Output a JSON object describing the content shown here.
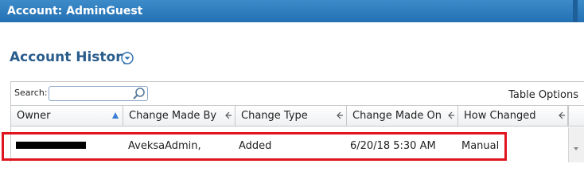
{
  "window": {
    "title": "Account: AdminGuest"
  },
  "page": {
    "title": "Account History"
  },
  "toolbar": {
    "search_label": "Search:",
    "search_value": "",
    "table_options_label": "Table Options"
  },
  "table": {
    "columns": [
      {
        "label": "Owner",
        "sort": "ascending"
      },
      {
        "label": "Change Made By"
      },
      {
        "label": "Change Type"
      },
      {
        "label": "Change Made On"
      },
      {
        "label": "How Changed"
      }
    ],
    "rows": [
      {
        "owner": "[redacted]",
        "change_made_by": "AveksaAdmin,",
        "change_type": "Added",
        "change_made_on": "6/20/18 5:30 AM",
        "how_changed": "Manual"
      }
    ]
  },
  "colors": {
    "titlebar": "#2b78bc",
    "page_title": "#2a5d8c",
    "highlight": "#e0141e"
  }
}
